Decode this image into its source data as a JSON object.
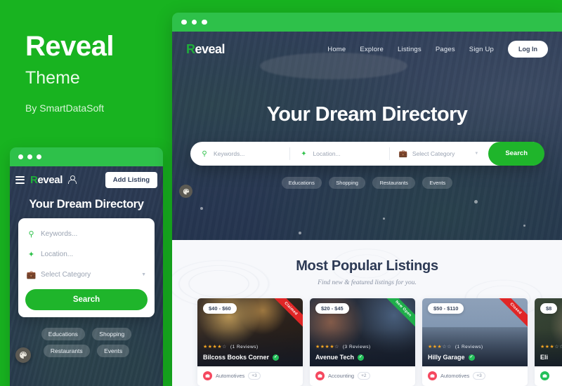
{
  "brand": {
    "title": "Reveal",
    "subtitle": "Theme",
    "author": "By SmartDataSoft",
    "green": "#18b320"
  },
  "mobile": {
    "window_dots": 3,
    "header": {
      "menu_icon": "hamburger-icon",
      "logo": "Reveal",
      "logo_mark": "R",
      "user_icon": "user-icon",
      "add_listing_label": "Add Listing"
    },
    "hero_title": "Your Dream Directory",
    "search": {
      "keywords_placeholder": "Keywords...",
      "keywords_icon": "search-icon",
      "location_placeholder": "Location...",
      "location_icon": "location-icon",
      "category_placeholder": "Select Category",
      "category_icon": "briefcase-icon",
      "caret_icon": "chevron-down-icon",
      "button_label": "Search"
    },
    "tags": [
      "Educations",
      "Shopping",
      "Restaurants",
      "Events"
    ],
    "palette_icon": "palette-icon"
  },
  "desktop": {
    "window_dots": 3,
    "nav": {
      "logo": "Reveal",
      "logo_mark": "R",
      "items": [
        {
          "label": "Home"
        },
        {
          "label": "Explore"
        },
        {
          "label": "Listings"
        },
        {
          "label": "Pages"
        },
        {
          "label": "Sign Up"
        }
      ],
      "login_label": "Log In"
    },
    "hero_title": "Your Dream Directory",
    "search": {
      "keywords_placeholder": "Keywords...",
      "keywords_icon": "search-icon",
      "location_placeholder": "Location...",
      "location_icon": "location-icon",
      "category_placeholder": "Select Category",
      "category_icon": "briefcase-icon",
      "caret_icon": "chevron-down-icon",
      "button_label": "Search"
    },
    "tags": [
      "Educations",
      "Shopping",
      "Restaurants",
      "Events"
    ],
    "palette_icon": "palette-icon",
    "listings": {
      "title": "Most Popular Listings",
      "subtitle": "Find new & featured listings for you.",
      "cards": [
        {
          "price": "$40 - $60",
          "ribbon": "Claimed",
          "ribbon_color": "#e02626",
          "stars_on": 4,
          "stars_total": 5,
          "reviews": "(1 Reviews)",
          "name": "Bilcoss Books Corner",
          "verified_icon": "check-badge-icon",
          "category": "Automotives",
          "category_more": "+3",
          "category_icon": "briefcase-icon"
        },
        {
          "price": "$20 - $45",
          "ribbon": "New Open",
          "ribbon_color": "#1fae4a",
          "stars_on": 4,
          "stars_total": 5,
          "reviews": "(3 Reviews)",
          "name": "Avenue Tech",
          "verified_icon": "check-badge-icon",
          "category": "Accounting",
          "category_more": "+2",
          "category_icon": "briefcase-icon"
        },
        {
          "price": "$50 - $110",
          "ribbon": "Closed",
          "ribbon_color": "#e02626",
          "stars_on": 3,
          "stars_total": 5,
          "reviews": "(1 Reviews)",
          "name": "Hilly Garage",
          "verified_icon": "check-badge-icon",
          "category": "Automotives",
          "category_more": "+3",
          "category_icon": "briefcase-icon"
        },
        {
          "price": "$8",
          "ribbon": "",
          "ribbon_color": "#e02626",
          "stars_on": 3,
          "stars_total": 5,
          "reviews": "",
          "name": "Eli",
          "verified_icon": "check-badge-icon",
          "category": "",
          "category_more": "",
          "category_icon": "briefcase-icon"
        }
      ]
    }
  }
}
